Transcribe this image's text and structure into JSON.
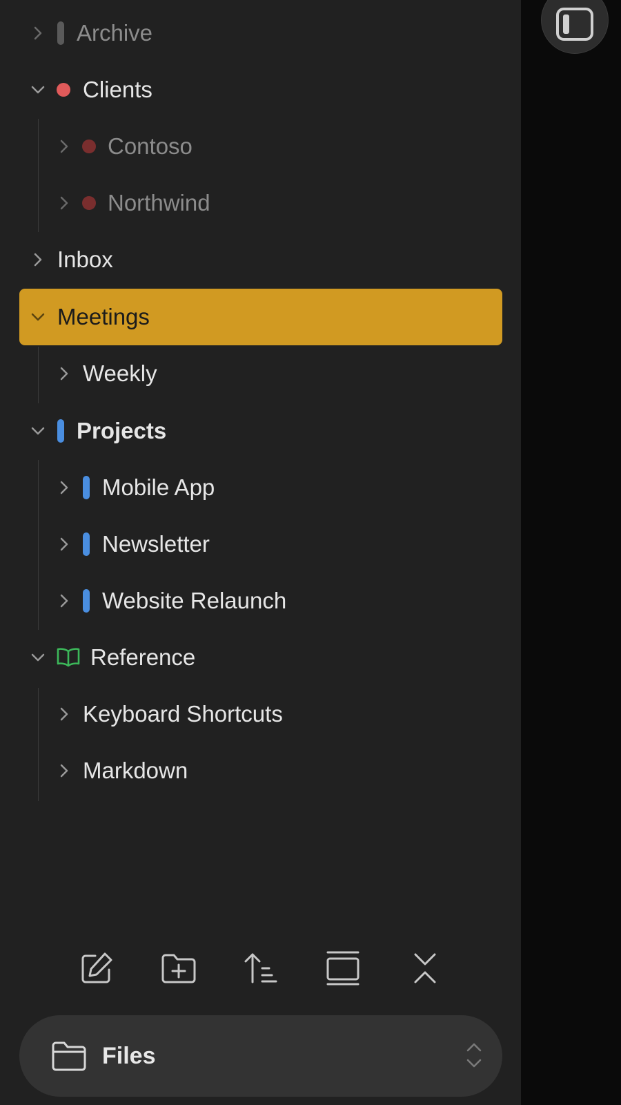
{
  "tree": {
    "archive": "Archive",
    "clients": "Clients",
    "contoso": "Contoso",
    "northwind": "Northwind",
    "inbox": "Inbox",
    "meetings": "Meetings",
    "weekly": "Weekly",
    "projects": "Projects",
    "mobile_app": "Mobile App",
    "newsletter": "Newsletter",
    "website_relaunch": "Website Relaunch",
    "reference": "Reference",
    "keyboard_shortcuts": "Keyboard Shortcuts",
    "markdown": "Markdown"
  },
  "toolbar": {
    "icons": [
      "new-note-icon",
      "new-folder-icon",
      "sort-icon",
      "collapse-view-icon",
      "collapse-all-icon"
    ]
  },
  "switcher": {
    "label": "Files",
    "icon": "folder-icon"
  },
  "colors": {
    "selected": "#d19a22",
    "clients": "#e05a5a",
    "clients_child": "#7a2e2e",
    "projects": "#4a8ee0",
    "reference": "#3cb85a",
    "archive": "#5a5a5a"
  }
}
